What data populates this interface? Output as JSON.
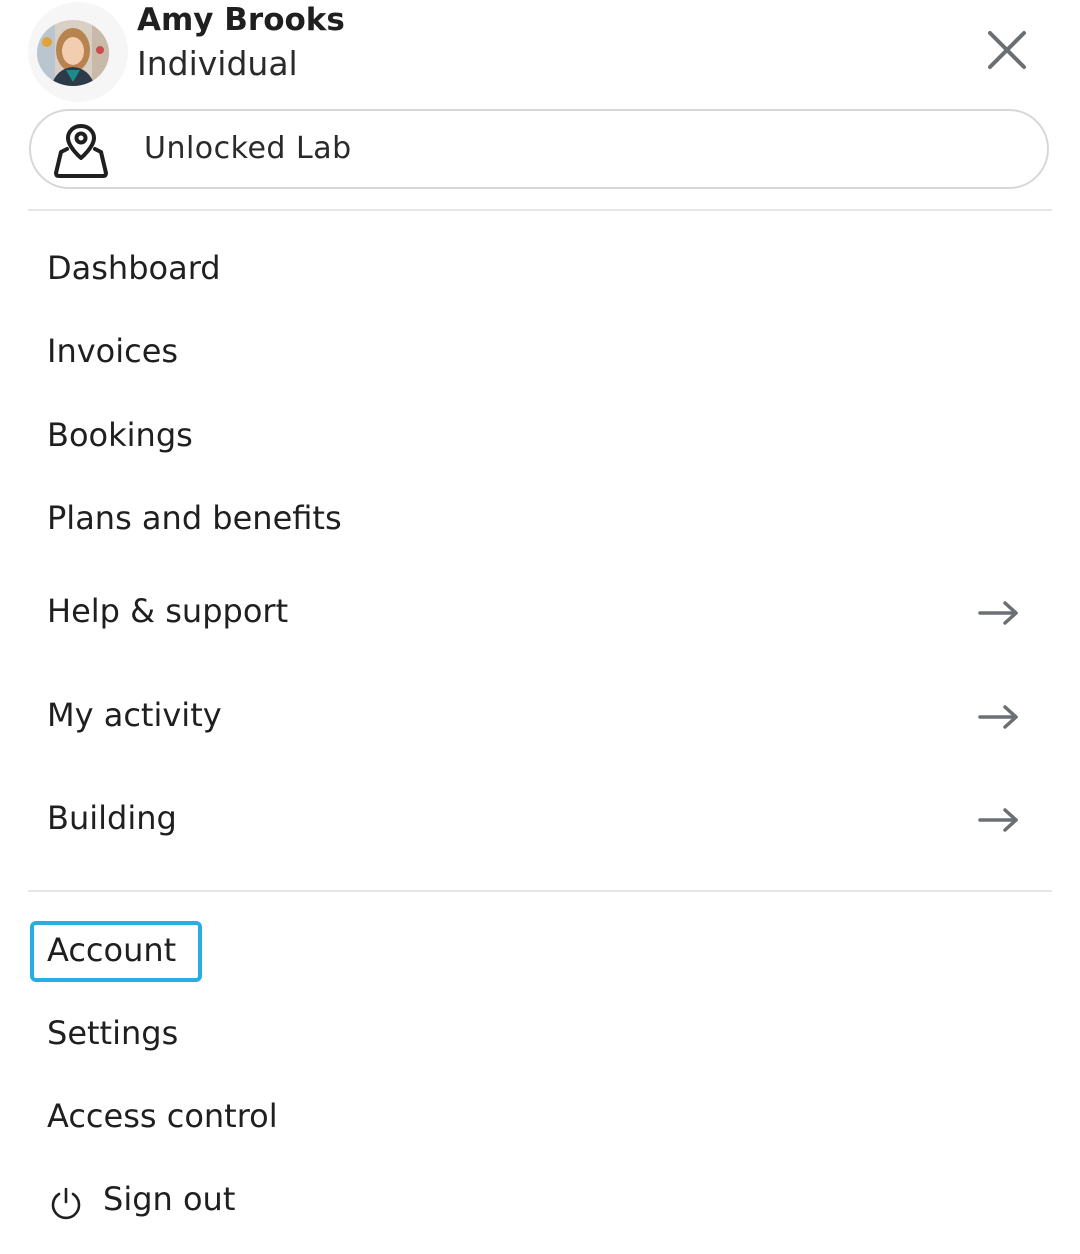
{
  "user": {
    "name": "Amy Brooks",
    "account_type": "Individual",
    "avatar_icon": "user-photo-avatar"
  },
  "close_icon": "close-icon",
  "location": {
    "icon": "map-pin-icon",
    "label": "Unlocked Lab"
  },
  "menu": {
    "primary": [
      {
        "label": "Dashboard"
      },
      {
        "label": "Invoices"
      },
      {
        "label": "Bookings"
      },
      {
        "label": "Plans and benefits"
      }
    ],
    "submenus": [
      {
        "label": "Help & support",
        "icon": "arrow-right-icon"
      },
      {
        "label": "My activity",
        "icon": "arrow-right-icon"
      },
      {
        "label": "Building",
        "icon": "arrow-right-icon"
      }
    ],
    "secondary": [
      {
        "label": "Account",
        "highlighted": true
      },
      {
        "label": "Settings"
      },
      {
        "label": "Access control"
      }
    ],
    "sign_out": {
      "label": "Sign out",
      "icon": "power-icon"
    }
  },
  "colors": {
    "text": "#1f1f1f",
    "divider": "#e6e6e6",
    "highlight": "#29aee3",
    "arrow": "#6b6f73"
  }
}
